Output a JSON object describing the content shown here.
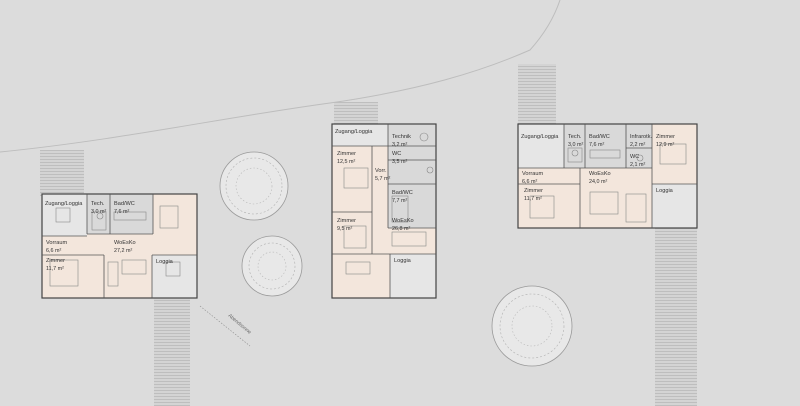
{
  "annotations": {
    "contour_label": "Abendsonne"
  },
  "buildings": [
    {
      "id": "left",
      "rooms": [
        {
          "key": "zugang",
          "name": "Zugang/Loggia",
          "area": ""
        },
        {
          "key": "tech",
          "name": "Tech.",
          "area": "3,0 m²"
        },
        {
          "key": "bad",
          "name": "Bad/WC",
          "area": "7,6 m²"
        },
        {
          "key": "vorraum",
          "name": "Vorraum",
          "area": "6,6 m²"
        },
        {
          "key": "zimmer",
          "name": "Zimmer",
          "area": "11,7 m²"
        },
        {
          "key": "woesko",
          "name": "WoEsKo",
          "area": "27,2 m²"
        },
        {
          "key": "loggia",
          "name": "Loggia",
          "area": ""
        }
      ]
    },
    {
      "id": "middle",
      "rooms": [
        {
          "key": "zugang",
          "name": "Zugang/Loggia",
          "area": ""
        },
        {
          "key": "technik",
          "name": "Technik",
          "area": "3,2 m²"
        },
        {
          "key": "zimmer1",
          "name": "Zimmer",
          "area": "12,5 m²"
        },
        {
          "key": "wc",
          "name": "WC",
          "area": "3,5 m²"
        },
        {
          "key": "vorr",
          "name": "Vorr.",
          "area": "5,7 m²"
        },
        {
          "key": "bad",
          "name": "Bad/WC",
          "area": "7,7 m²"
        },
        {
          "key": "zimmer2",
          "name": "Zimmer",
          "area": "9,5 m²"
        },
        {
          "key": "woesko",
          "name": "WoEsKo",
          "area": "26,8 m²"
        },
        {
          "key": "loggia",
          "name": "Loggia",
          "area": ""
        }
      ]
    },
    {
      "id": "right",
      "rooms": [
        {
          "key": "zugang",
          "name": "Zugang/Loggia",
          "area": ""
        },
        {
          "key": "tech",
          "name": "Tech.",
          "area": "3,0 m²"
        },
        {
          "key": "bad",
          "name": "Bad/WC",
          "area": "7,6 m²"
        },
        {
          "key": "infrarot",
          "name": "Infrarotk.",
          "area": "2,2 m²"
        },
        {
          "key": "zimmer1",
          "name": "Zimmer",
          "area": "12,9 m²"
        },
        {
          "key": "wc",
          "name": "WC",
          "area": "2,1 m²"
        },
        {
          "key": "vorraum",
          "name": "Vorraum",
          "area": "6,6 m²"
        },
        {
          "key": "woesko",
          "name": "WoEsKo",
          "area": "24,0 m²"
        },
        {
          "key": "zimmer2",
          "name": "Zimmer",
          "area": "11,7 m²"
        },
        {
          "key": "loggia",
          "name": "Loggia",
          "area": ""
        }
      ]
    }
  ]
}
